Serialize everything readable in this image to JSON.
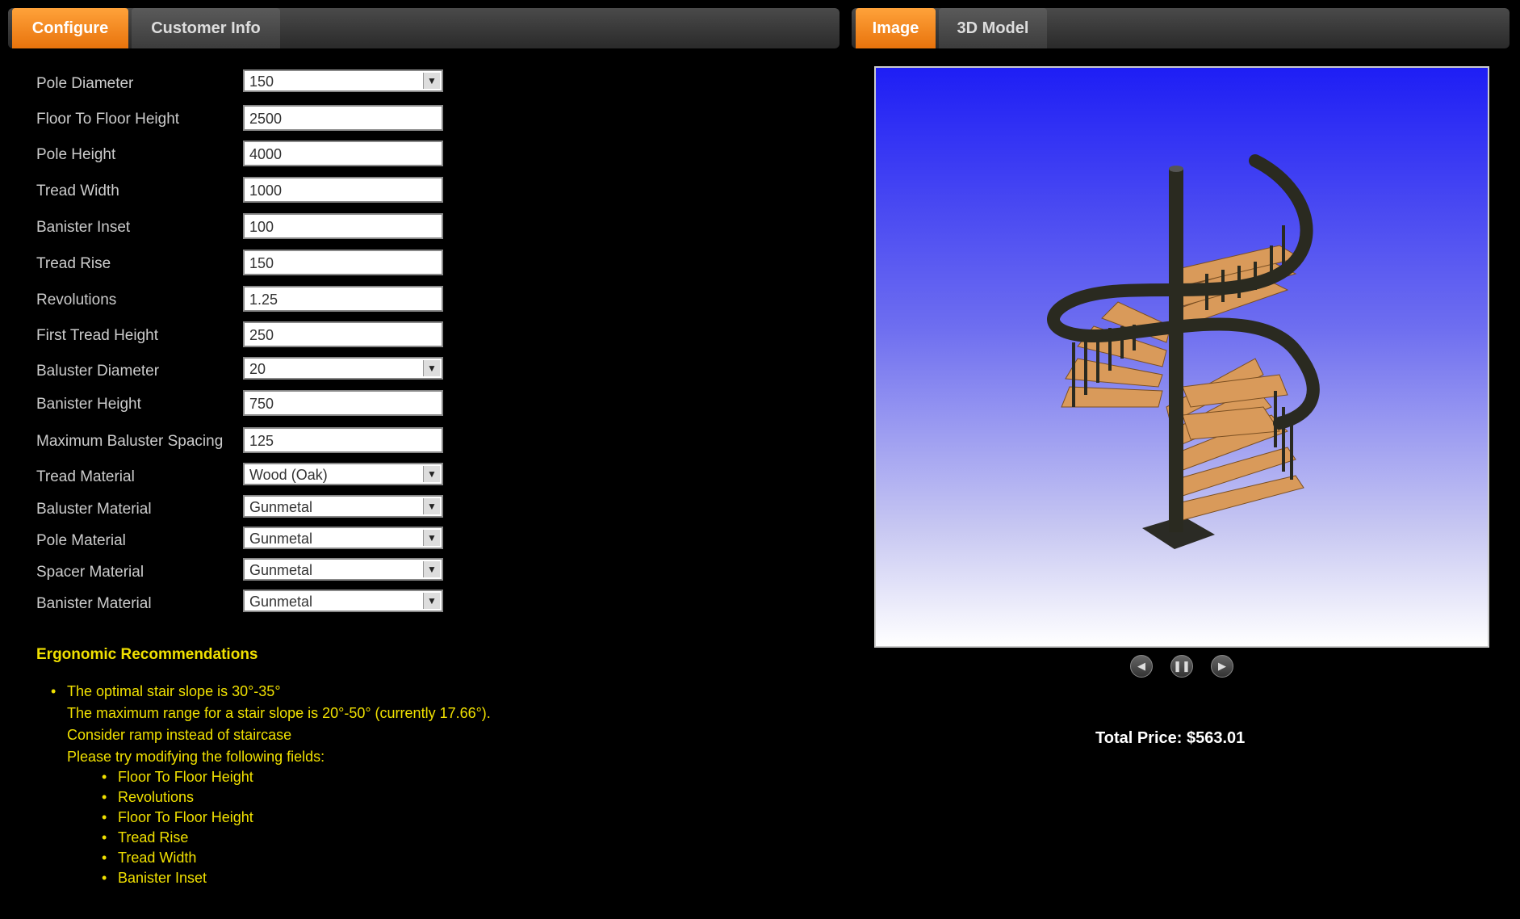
{
  "left_tabs": [
    "Configure",
    "Customer Info"
  ],
  "right_tabs": [
    "Image",
    "3D Model"
  ],
  "form": [
    {
      "label": "Pole Diameter",
      "value": "150",
      "type": "select"
    },
    {
      "label": "Floor To Floor Height",
      "value": "2500",
      "type": "input"
    },
    {
      "label": "Pole Height",
      "value": "4000",
      "type": "input"
    },
    {
      "label": "Tread Width",
      "value": "1000",
      "type": "input"
    },
    {
      "label": "Banister Inset",
      "value": "100",
      "type": "input"
    },
    {
      "label": "Tread Rise",
      "value": "150",
      "type": "input"
    },
    {
      "label": "Revolutions",
      "value": "1.25",
      "type": "input"
    },
    {
      "label": "First Tread Height",
      "value": "250",
      "type": "input"
    },
    {
      "label": "Baluster Diameter",
      "value": "20",
      "type": "select"
    },
    {
      "label": "Banister Height",
      "value": "750",
      "type": "input"
    },
    {
      "label": "Maximum Baluster Spacing",
      "value": "125",
      "type": "input"
    },
    {
      "label": "Tread Material",
      "value": "Wood (Oak)",
      "type": "select"
    },
    {
      "label": "Baluster Material",
      "value": "Gunmetal",
      "type": "select"
    },
    {
      "label": "Pole Material",
      "value": "Gunmetal",
      "type": "select"
    },
    {
      "label": "Spacer Material",
      "value": "Gunmetal",
      "type": "select"
    },
    {
      "label": "Banister Material",
      "value": "Gunmetal",
      "type": "select"
    }
  ],
  "ergonomic": {
    "title": "Ergonomic Recommendations",
    "lines": [
      "The optimal stair slope is 30°-35°",
      "The maximum range for a stair slope is 20°-50° (currently 17.66°).",
      "Consider ramp instead of staircase",
      "Please try modifying the following fields:"
    ],
    "fields": [
      "Floor To Floor Height",
      "Revolutions",
      "Floor To Floor Height",
      "Tread Rise",
      "Tread Width",
      "Banister Inset"
    ]
  },
  "viewer_controls": [
    "rotate-left-icon",
    "pause-icon",
    "rotate-right-icon"
  ],
  "total_price": "Total Price: $563.01",
  "colors": {
    "accent": "#f5861f",
    "ergonomic_text": "#f0e000",
    "tread": "#d99a5a",
    "metal": "#2a2a20"
  }
}
